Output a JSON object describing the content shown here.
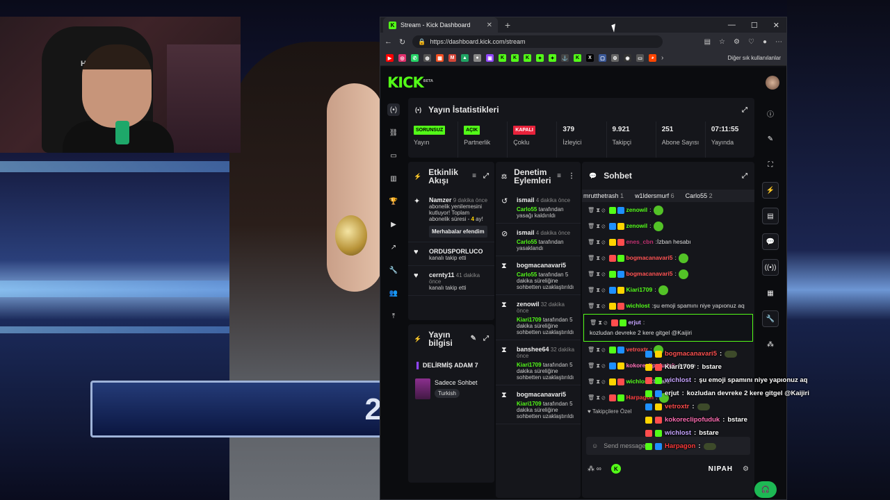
{
  "browser": {
    "tab_title": "Stream - Kick Dashboard",
    "url": "https://dashboard.kick.com/stream",
    "other_bookmarks": "Diğer sık kullanılanlar"
  },
  "stats": {
    "title": "Yayın İstatistikleri",
    "cells": [
      {
        "badge": "SORUNSUZ",
        "badge_color": "#53fc18",
        "label": "Yayın"
      },
      {
        "badge": "AÇIK",
        "badge_color": "#53fc18",
        "label": "Partnerlik"
      },
      {
        "badge": "KAPALI",
        "badge_color": "#e8223b",
        "label": "Çoklu"
      },
      {
        "value": "379",
        "label": "İzleyici"
      },
      {
        "value": "9.921",
        "label": "Takipçi"
      },
      {
        "value": "251",
        "label": "Abone Sayısı"
      },
      {
        "value": "07:11:55",
        "label": "Yayında"
      }
    ]
  },
  "activity": {
    "title": "Etkinlik Akışı",
    "events": [
      {
        "user": "Namzer",
        "time": "9 dakika önce",
        "text": "abonelik yenilemesini kutluyor! Toplam abonelik süresi -",
        "months": "4",
        "suffix": "ay!",
        "button": "Merhabalar efendim"
      },
      {
        "user": "ORDUSPORLUCO",
        "text": "kanalı takip etti"
      },
      {
        "user": "cernty11",
        "time": "41 dakika önce",
        "text": "kanalı takip etti"
      }
    ]
  },
  "moderation": {
    "title": "Denetim Eylemleri",
    "events": [
      {
        "user": "ismail",
        "time": "4 dakika önce",
        "mod": "Carlo55",
        "text": "tarafından yasağı kaldırıldı"
      },
      {
        "user": "ismail",
        "time": "4 dakika önce",
        "mod": "Carlo55",
        "text": "tarafından yasaklandı"
      },
      {
        "user": "bogmacanavari5",
        "time": "",
        "mod": "Carlo55",
        "text": "tarafından 5 dakika süreliğine sohbetten uzaklaştırıldı"
      },
      {
        "user": "zenowil",
        "time": "32 dakika önce",
        "mod": "Kiari1709",
        "text": "tarafından 5 dakika süreliğine sohbetten uzaklaştırıldı"
      },
      {
        "user": "banshee64",
        "time": "32 dakika önce",
        "mod": "Kiari1709",
        "text": "tarafından 5 dakika süreliğine sohbetten uzaklaştırıldı"
      },
      {
        "user": "bogmacanavari5",
        "time": "",
        "mod": "Kiari1709",
        "text": "tarafından 5 dakika süreliğine sohbetten uzaklaştırıldı"
      }
    ]
  },
  "info": {
    "title": "Yayın bilgisi",
    "stream_title": "DELİRMİŞ ADAM 7",
    "category": "Sadece Sohbet",
    "language": "Turkish"
  },
  "chat": {
    "title": "Sohbet",
    "pinned": [
      {
        "user": "mrutthetrash",
        "count": "1"
      },
      {
        "user": "w1ldersmurf",
        "count": "6"
      },
      {
        "user": "Carlo55",
        "count": "2"
      }
    ],
    "messages": [
      {
        "user": "zenowil",
        "color": "#53fc18",
        "text": ""
      },
      {
        "user": "zenowil",
        "color": "#53fc18",
        "text": ""
      },
      {
        "user": "enes_cbn",
        "color": "#c03070",
        "text": "İzban hesabı"
      },
      {
        "user": "bogmacanavari5",
        "color": "#ff5252",
        "text": ""
      },
      {
        "user": "bogmacanavari5",
        "color": "#ff5252",
        "text": ""
      },
      {
        "user": "Kiari1709",
        "color": "#53fc18",
        "text": ""
      },
      {
        "user": "wichlost",
        "color": "#53fc18",
        "text": "şu emoji spamını niye yapıonuz aq"
      },
      {
        "user": "erjut",
        "color": "#c6a4ff",
        "text": "kozludan devreke 2 kere gitgel @Kaijiri"
      },
      {
        "user": "vetroxtr",
        "color": "#ff4d4d",
        "text": ""
      },
      {
        "user": "kokoreclipofuduk",
        "color": "#ff6eb4",
        "text": "bstare"
      },
      {
        "user": "wichlost",
        "color": "#53fc18",
        "text": "bstare"
      },
      {
        "user": "Harpagon",
        "color": "#ff3b3b",
        "text": ""
      }
    ],
    "follower_mode": "Takipçilere Özel",
    "placeholder": "Send message..",
    "footer_brand": "NIPAH"
  },
  "overlay": [
    {
      "user": "bogmacanavari5",
      "color": "#ff5252",
      "text": ""
    },
    {
      "user": "Kiari1709",
      "color": "#ffffff",
      "text": "bstare"
    },
    {
      "user": "wichlost",
      "color": "#c6a4ff",
      "text": "şu emoji spamını niye yapıonuz aq"
    },
    {
      "user": "erjut",
      "color": "#ffffff",
      "text": "kozludan devreke 2 kere gitgel @Kaijiri"
    },
    {
      "user": "vetroxtr",
      "color": "#ff4d4d",
      "text": ""
    },
    {
      "user": "kokoreclipofuduk",
      "color": "#ff6eb4",
      "text": "bstare"
    },
    {
      "user": "wichlost",
      "color": "#c6a4ff",
      "text": "bstare"
    },
    {
      "user": "Harpagon",
      "color": "#ff3b3b",
      "text": ""
    }
  ],
  "background": {
    "show_number": "2"
  },
  "webcam": {
    "chair_brand": "HAWK"
  },
  "icons": {
    "help": "headset-icon"
  }
}
